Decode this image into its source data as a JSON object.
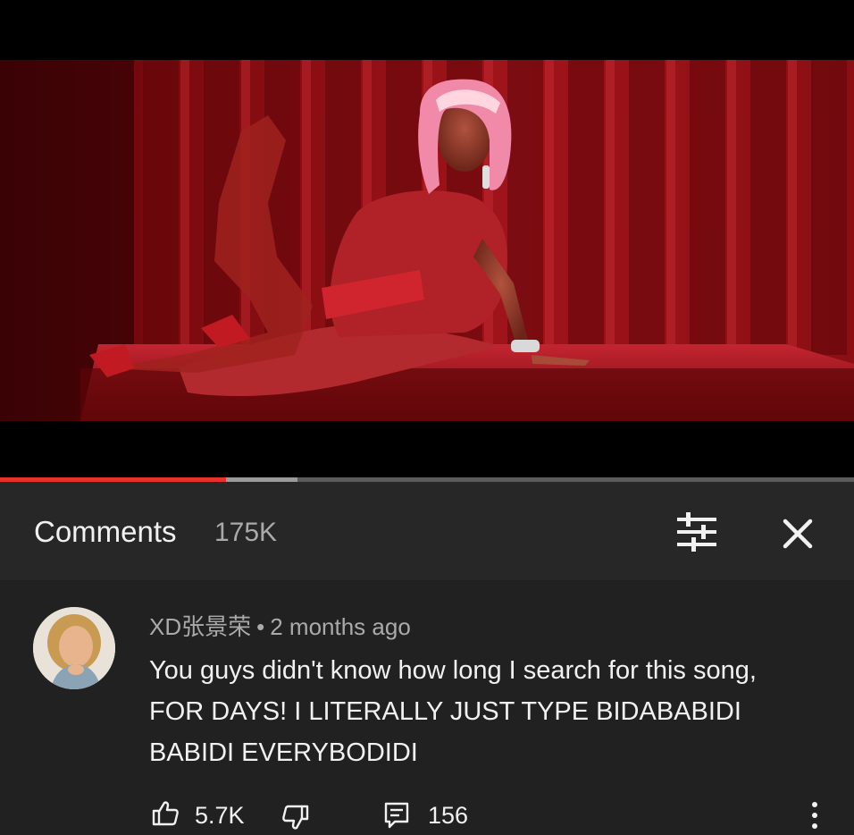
{
  "video": {
    "progress_played": 0.265,
    "progress_buffered": 0.348,
    "colors": {
      "played": "#e8302c",
      "buffered": "#9a9a9a",
      "track": "#5b5b5b"
    }
  },
  "comments_panel": {
    "title": "Comments",
    "count": "175K",
    "filter_icon": "sort-filter-icon",
    "close_icon": "close-icon"
  },
  "comment": {
    "author": "XD张景荣",
    "separator": "•",
    "time": "2 months ago",
    "text": "You guys didn't know how long I search for this song, FOR DAYS! I LITERALLY JUST TYPE BIDABABIDI BABIDI EVERYBODIDI",
    "likes": "5.7K",
    "replies": "156",
    "icons": [
      "thumbs-up-icon",
      "thumbs-down-icon",
      "reply-icon",
      "more-vert-icon"
    ]
  }
}
